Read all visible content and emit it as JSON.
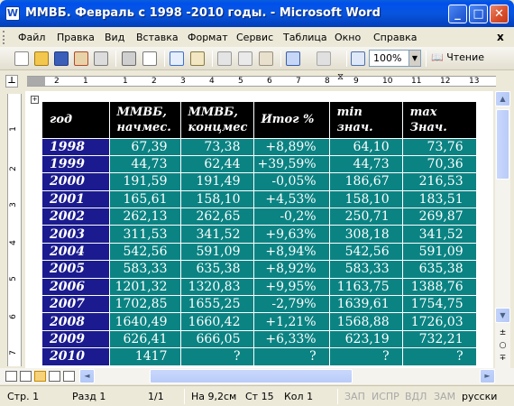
{
  "window": {
    "title": "ММВБ. Февраль с 1998 -2010 годы. - Microsoft Word",
    "app_icon": "W",
    "minimize": "_",
    "maximize": "□",
    "close": "✕"
  },
  "menu": {
    "items": [
      "Файл",
      "Правка",
      "Вид",
      "Вставка",
      "Формат",
      "Сервис",
      "Таблица",
      "Окно",
      "Справка"
    ],
    "close_doc": "x"
  },
  "toolbar": {
    "zoom": "100%",
    "reading": "Чтение",
    "icons": [
      "new-document-icon",
      "open-icon",
      "save-icon",
      "permission-icon",
      "email-icon",
      "print-icon",
      "print-preview-icon",
      "spelling-icon",
      "research-icon",
      "cut-icon",
      "copy-icon",
      "paste-icon",
      "format-painter-icon",
      "undo-icon",
      "redo-icon",
      "hyperlink-icon"
    ]
  },
  "ruler": {
    "corner": "⊥",
    "numbers": [
      "2",
      "1",
      "1",
      "2",
      "3",
      "4",
      "5",
      "6",
      "7",
      "8",
      "9",
      "10",
      "11",
      "12",
      "13"
    ],
    "vnumbers": [
      "1",
      "2",
      "3",
      "4",
      "5",
      "6",
      "7"
    ]
  },
  "table": {
    "header": [
      "год",
      "ММВБ, начмес.",
      "ММВБ, концмес",
      "Итог %",
      "min знач.",
      "max Знач."
    ],
    "rows": [
      [
        "1998",
        "67,39",
        "73,38",
        "+8,89%",
        "64,10",
        "73,76"
      ],
      [
        "1999",
        "44,73",
        "62,44",
        "+39,59%",
        "44,73",
        "70,36"
      ],
      [
        "2000",
        "191,59",
        "191,49",
        "-0,05%",
        "186,67",
        "216,53"
      ],
      [
        "2001",
        "165,61",
        "158,10",
        "+4,53%",
        "158,10",
        "183,51"
      ],
      [
        "2002",
        "262,13",
        "262,65",
        "-0,2%",
        "250,71",
        "269,87"
      ],
      [
        "2003",
        "311,53",
        "341,52",
        "+9,63%",
        "308,18",
        "341,52"
      ],
      [
        "2004",
        "542,56",
        "591,09",
        "+8,94%",
        "542,56",
        "591,09"
      ],
      [
        "2005",
        "583,33",
        "635,38",
        "+8,92%",
        "583,33",
        "635,38"
      ],
      [
        "2006",
        "1201,32",
        "1320,83",
        "+9,95%",
        "1163,75",
        "1388,76"
      ],
      [
        "2007",
        "1702,85",
        "1655,25",
        "-2,79%",
        "1639,61",
        "1754,75"
      ],
      [
        "2008",
        "1640,49",
        "1660,42",
        "+1,21%",
        "1568,88",
        "1726,03"
      ],
      [
        "2009",
        "626,41",
        "666,05",
        "+6,33%",
        "623,19",
        "732,21"
      ],
      [
        "2010",
        "1417",
        "?",
        "?",
        "?",
        "?"
      ]
    ]
  },
  "statusbar": {
    "page": "Стр. 1",
    "section": "Разд 1",
    "pages": "1/1",
    "at": "На 9,2см",
    "line": "Ст 15",
    "col": "Кол 1",
    "rec": "ЗАП",
    "trk": "ИСПР",
    "ext": "ВДЛ",
    "ovr": "ЗАМ",
    "lang": "русски"
  }
}
